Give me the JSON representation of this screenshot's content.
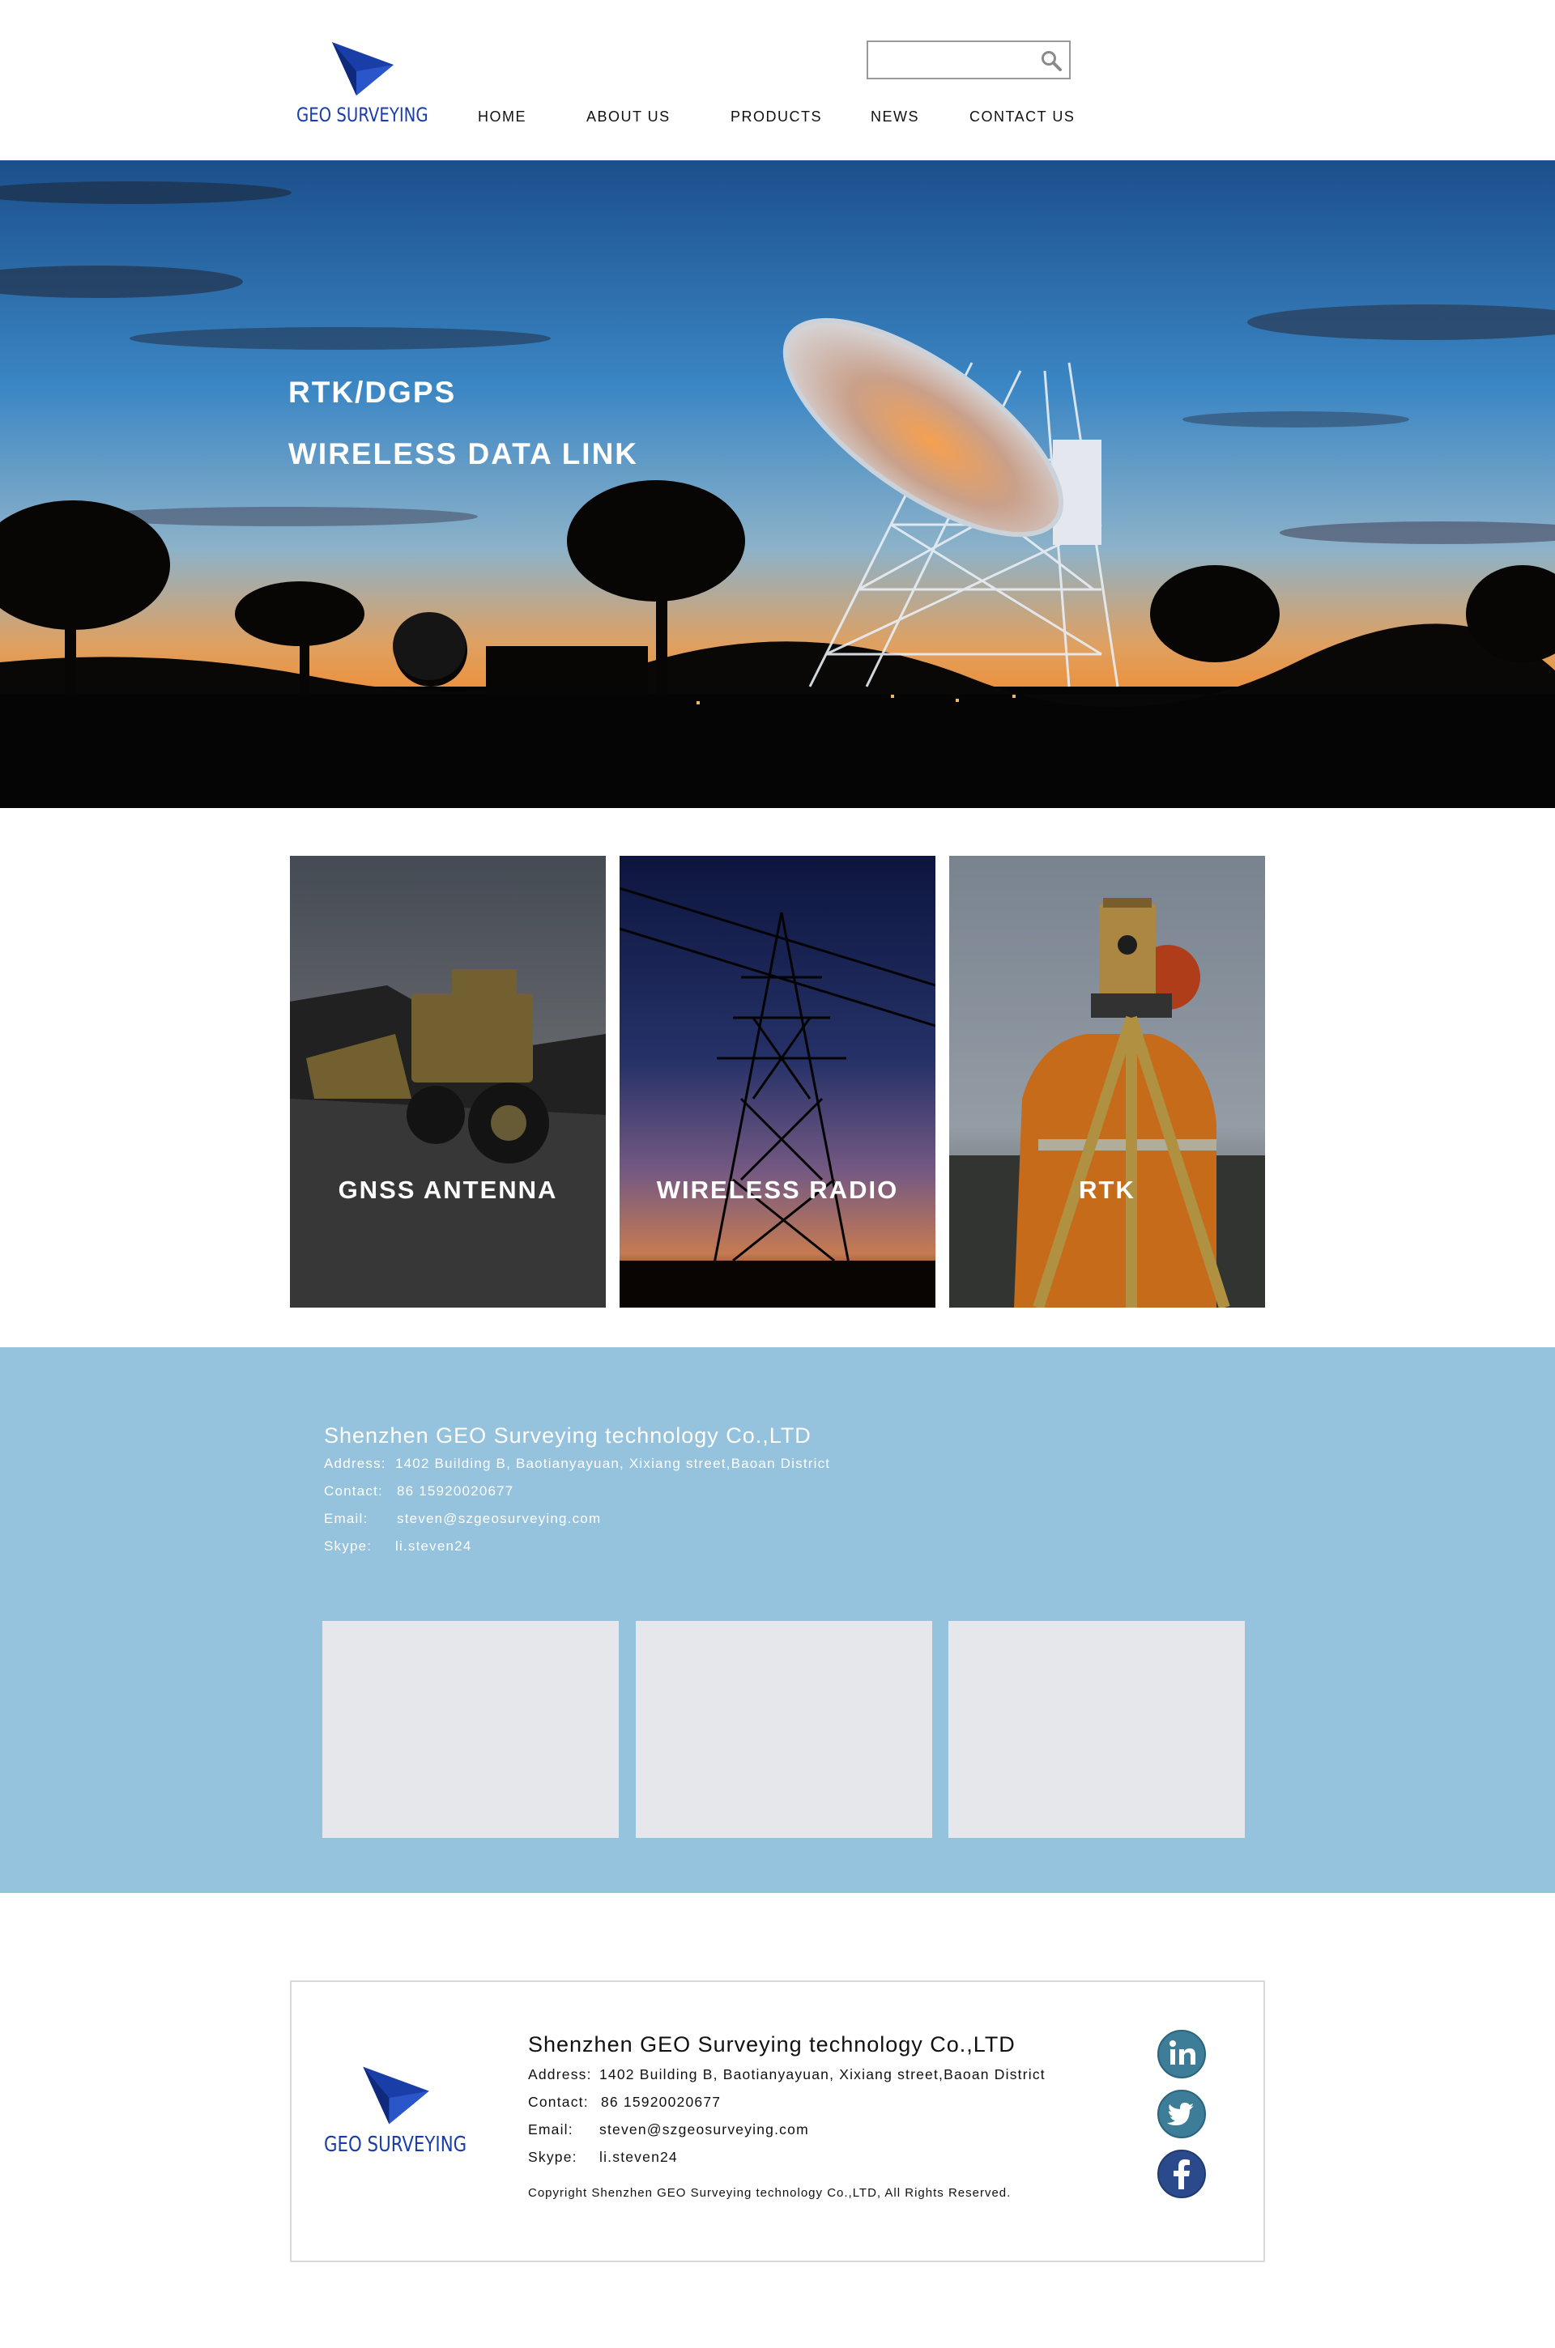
{
  "header": {
    "logo_text": "GEO SURVEYING",
    "search": {
      "placeholder": "",
      "icon": "search-icon"
    },
    "nav": [
      "HOME",
      "ABOUT US",
      "PRODUCTS",
      "NEWS",
      "CONTACT US"
    ]
  },
  "hero": {
    "line1": "RTK/DGPS",
    "line2": "WIRELESS DATA LINK"
  },
  "cards": [
    {
      "label": "GNSS ANTENNA"
    },
    {
      "label": "WIRELESS RADIO"
    },
    {
      "label": "RTK"
    }
  ],
  "contact": {
    "company": "Shenzhen GEO Surveying technology Co.,LTD",
    "address_label": "Address:",
    "address": "1402 Building B, Baotianyayuan, Xixiang street,Baoan District",
    "contact_label": "Contact:",
    "contact": "86 15920020677",
    "email_label": "Email:",
    "email": "steven@szgeosurveying.com",
    "skype_label": "Skype:",
    "skype": "li.steven24"
  },
  "footer": {
    "logo_text": "GEO SURVEYING",
    "company": "Shenzhen GEO Surveying technology Co.,LTD",
    "address_label": "Address:",
    "address": "1402 Building B, Baotianyayuan, Xixiang street,Baoan District",
    "contact_label": "Contact:",
    "contact": "86 15920020677",
    "email_label": "Email:",
    "email": "steven@szgeosurveying.com",
    "skype_label": "Skype:",
    "skype": "li.steven24",
    "copyright": "Copyright Shenzhen GEO Surveying technology Co.,LTD, All Rights Reserved.",
    "social": [
      "linkedin-icon",
      "twitter-icon",
      "facebook-icon"
    ]
  },
  "colors": {
    "brand_blue": "#1a3ea8",
    "contact_band": "#95c2dc",
    "placeholder": "#e6e7ea",
    "social_teal": "#3d7d98",
    "social_navy": "#2b4a8b"
  }
}
